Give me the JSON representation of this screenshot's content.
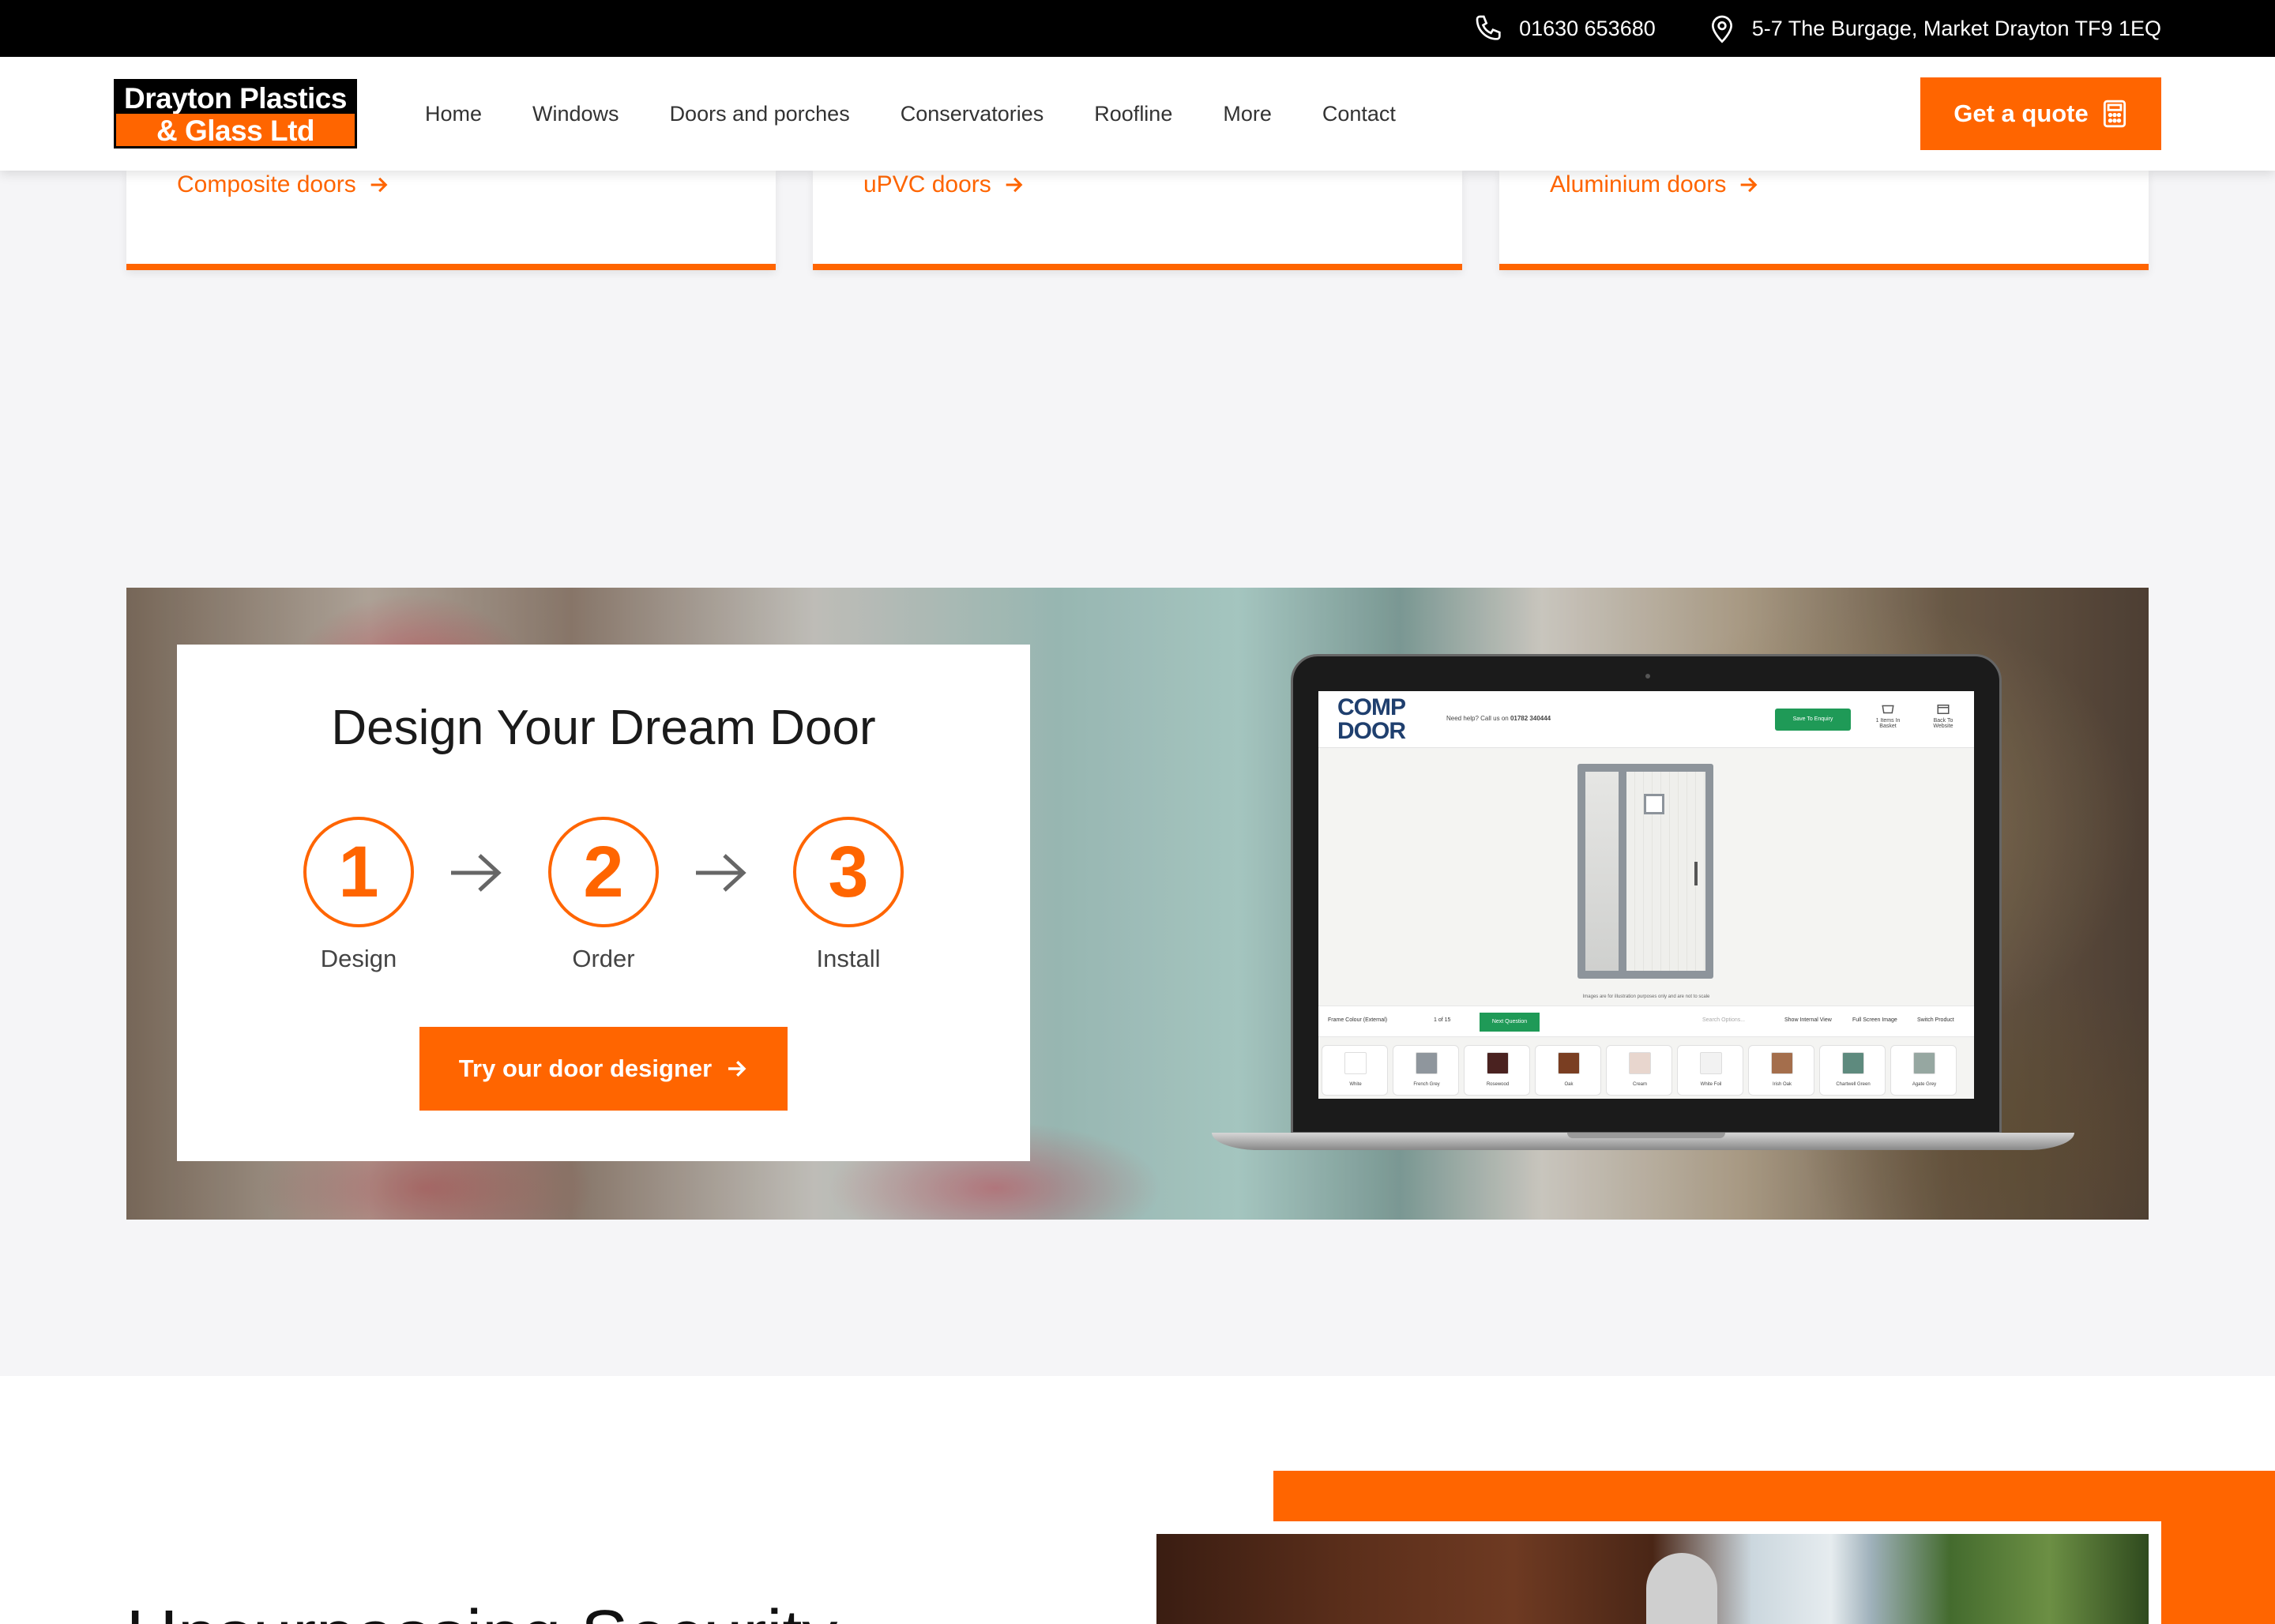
{
  "topbar": {
    "phone": "01630 653680",
    "address": "5-7 The Burgage, Market Drayton TF9 1EQ",
    "phone_icon": "phone-icon",
    "address_icon": "map-pin-icon"
  },
  "header": {
    "logo_line1": "Drayton Plastics",
    "logo_line2": "& Glass Ltd",
    "nav": [
      "Home",
      "Windows",
      "Doors and porches",
      "Conservatories",
      "Roofline",
      "More",
      "Contact"
    ],
    "quote_button": "Get a quote",
    "quote_icon": "calculator-icon"
  },
  "cards": [
    "Composite doors",
    "uPVC doors",
    "Aluminium doors"
  ],
  "designer": {
    "title": "Design Your Dream Door",
    "steps": [
      {
        "number": "1",
        "label": "Design"
      },
      {
        "number": "2",
        "label": "Order"
      },
      {
        "number": "3",
        "label": "Install"
      }
    ],
    "button": "Try our door designer"
  },
  "laptop_screen": {
    "logo_line1": "COMP",
    "logo_line2": "DOOR",
    "help_text": "Need help? Call us on",
    "help_phone": "01782 340444",
    "save_button": "Save To Enquiry",
    "basket": "1 Items In Basket",
    "back": "Back To Website",
    "note": "Images are for illustration purposes only and are not to scale",
    "toolbar": {
      "question": "Frame Colour (External)",
      "counter": "1 of 15",
      "next": "Next Question",
      "search_placeholder": "Search Options...",
      "internal_view": "Show Internal View",
      "full_screen": "Full Screen Image",
      "switch_product": "Switch Product"
    },
    "swatches": [
      {
        "name": "White",
        "color": "#ffffff"
      },
      {
        "name": "French Grey",
        "color": "#8f969d"
      },
      {
        "name": "Rosewood",
        "color": "#4a2220"
      },
      {
        "name": "Oak",
        "color": "#7a3e22"
      },
      {
        "name": "Cream",
        "color": "#e8d6ce"
      },
      {
        "name": "White Foil",
        "color": "#f2f2f2"
      },
      {
        "name": "Irish Oak",
        "color": "#a46e4c"
      },
      {
        "name": "Chartwell Green",
        "color": "#5e8a7e"
      },
      {
        "name": "Agate Grey",
        "color": "#96a7a1"
      }
    ]
  },
  "bottom": {
    "heading": "Unsurpassing Security"
  },
  "colors": {
    "accent": "#ff6500",
    "topbar": "#000000",
    "designer_green": "#1f9a57"
  }
}
